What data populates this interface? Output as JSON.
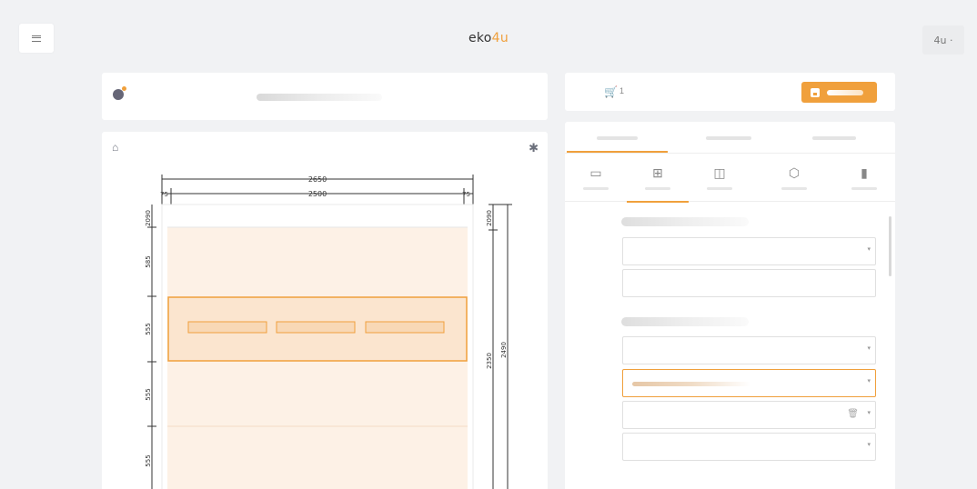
{
  "header": {
    "brand_part1": "eko",
    "brand_part2": "4u",
    "user_label": "4u ·"
  },
  "cart": {
    "count": "1"
  },
  "drawing": {
    "total_width": "2650",
    "inner_width": "2500",
    "margin_left": "75",
    "margin_right": "75",
    "top_height": "2090",
    "top_height_right": "2090",
    "total_height": "2490",
    "inner_height": "2350",
    "segments": [
      "585",
      "555",
      "555",
      "555"
    ]
  },
  "colors": {
    "accent": "#f0a03c",
    "panel_fill": "#fdf1e6"
  },
  "icons": {
    "menu": "hamburger-icon",
    "info": "info-icon",
    "basket": "basket-icon",
    "settings": "gear-icon",
    "cart": "cart-icon",
    "save": "save-icon",
    "delete": "trash-icon"
  }
}
